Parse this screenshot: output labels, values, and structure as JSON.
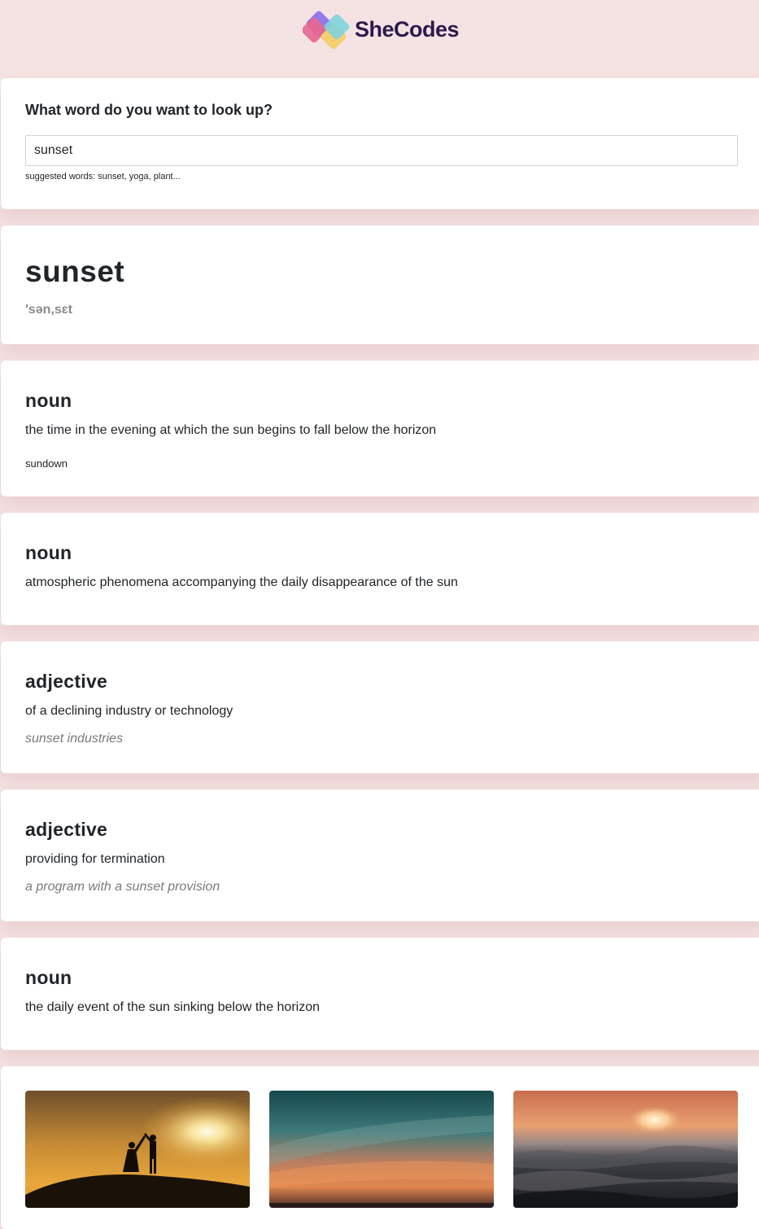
{
  "header": {
    "brand": "SheCodes"
  },
  "search": {
    "title": "What word do you want to look up?",
    "value": "sunset",
    "hint": "suggested words: sunset, yoga, plant..."
  },
  "result": {
    "word": "sunset",
    "phonetic": "'sən,sɛt"
  },
  "meanings": [
    {
      "part_of_speech": "noun",
      "definition": "the time in the evening at which the sun begins to fall below the horizon",
      "synonyms": "sundown"
    },
    {
      "part_of_speech": "noun",
      "definition": "atmospheric phenomena accompanying the daily disappearance of the sun"
    },
    {
      "part_of_speech": "adjective",
      "definition": "of a declining industry or technology",
      "example": "sunset industries"
    },
    {
      "part_of_speech": "adjective",
      "definition": "providing for termination",
      "example": "a program with a sunset provision"
    },
    {
      "part_of_speech": "noun",
      "definition": "the daily event of the sun sinking below the horizon"
    }
  ],
  "photos": [
    {
      "subject": "couple-silhouette-sunset"
    },
    {
      "subject": "teal-orange-sky-sunset"
    },
    {
      "subject": "ocean-waves-sunset"
    }
  ]
}
